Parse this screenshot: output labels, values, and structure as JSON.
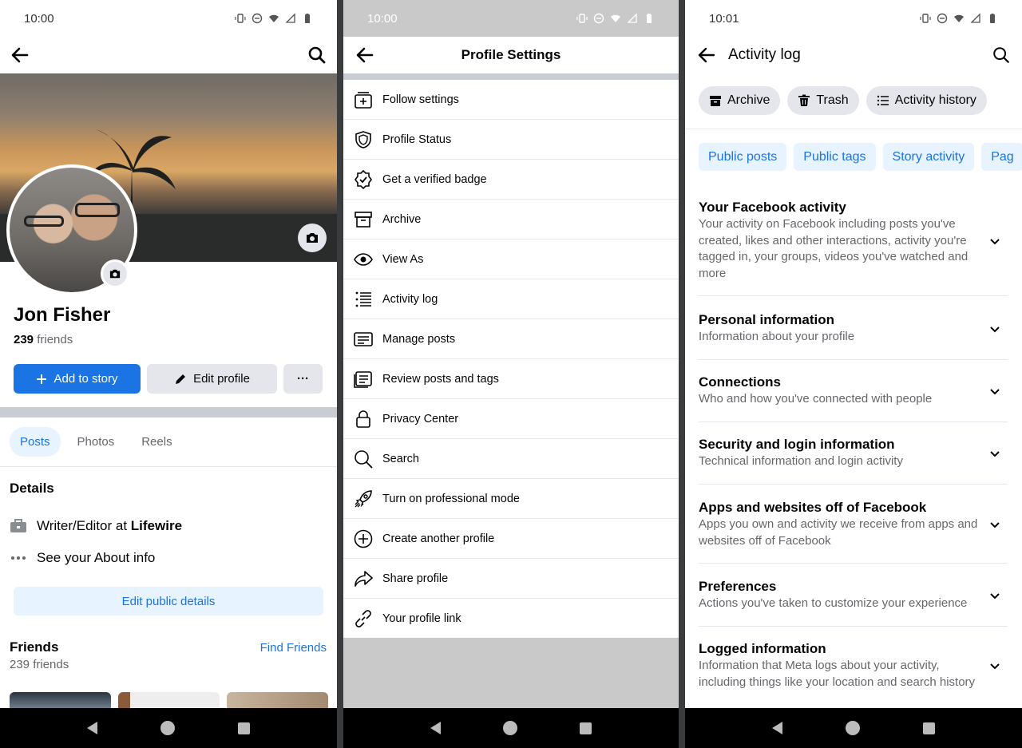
{
  "panel1": {
    "status_time": "10:00",
    "name": "Jon Fisher",
    "friends_count": "239",
    "friends_word": "friends",
    "add_story_label": "Add to story",
    "edit_profile_label": "Edit profile",
    "more_label": "···",
    "tabs": [
      {
        "label": "Posts",
        "active": true
      },
      {
        "label": "Photos",
        "active": false
      },
      {
        "label": "Reels",
        "active": false
      }
    ],
    "details_title": "Details",
    "work_prefix": "Writer/Editor at ",
    "work_company": "Lifewire",
    "about_label": "See your About info",
    "edit_public_label": "Edit public details",
    "friends_title": "Friends",
    "friends_sub": "239 friends",
    "find_friends_label": "Find Friends"
  },
  "panel2": {
    "status_time": "10:00",
    "title": "Profile Settings",
    "menu": [
      {
        "label": "Follow settings",
        "icon": "follow-icon"
      },
      {
        "label": "Profile Status",
        "icon": "shield-icon"
      },
      {
        "label": "Get a verified badge",
        "icon": "verified-badge-icon"
      },
      {
        "label": "Archive",
        "icon": "archive-icon"
      },
      {
        "label": "View As",
        "icon": "eye-icon"
      },
      {
        "label": "Activity log",
        "icon": "list-icon"
      },
      {
        "label": "Manage posts",
        "icon": "posts-icon"
      },
      {
        "label": "Review posts and tags",
        "icon": "review-icon"
      },
      {
        "label": "Privacy Center",
        "icon": "lock-icon"
      },
      {
        "label": "Search",
        "icon": "search-icon"
      },
      {
        "label": "Turn on professional mode",
        "icon": "rocket-icon"
      },
      {
        "label": "Create another profile",
        "icon": "plus-circle-icon"
      },
      {
        "label": "Share profile",
        "icon": "share-icon"
      },
      {
        "label": "Your profile link",
        "icon": "link-icon"
      }
    ]
  },
  "panel3": {
    "status_time": "10:01",
    "title": "Activity log",
    "chips": [
      {
        "label": "Archive",
        "icon": "archive-icon"
      },
      {
        "label": "Trash",
        "icon": "trash-icon"
      },
      {
        "label": "Activity history",
        "icon": "list-icon"
      }
    ],
    "pills": [
      "Public posts",
      "Public tags",
      "Story activity",
      "Pag"
    ],
    "sections": [
      {
        "title": "Your Facebook activity",
        "desc": "Your activity on Facebook including posts you've created, likes and other interactions, activity you're tagged in, your groups, videos you've watched and more"
      },
      {
        "title": "Personal information",
        "desc": "Information about your profile"
      },
      {
        "title": "Connections",
        "desc": "Who and how you've connected with people"
      },
      {
        "title": "Security and login information",
        "desc": "Technical information and login activity"
      },
      {
        "title": "Apps and websites off of Facebook",
        "desc": "Apps you own and activity we receive from apps and websites off of Facebook"
      },
      {
        "title": "Preferences",
        "desc": "Actions you've taken to customize your experience"
      },
      {
        "title": "Logged information",
        "desc": "Information that Meta logs about your activity, including things like your location and search history"
      }
    ]
  },
  "colors": {
    "accent": "#1b74e4",
    "accent_light": "#e7f3ff",
    "gray_button": "#e4e6eb",
    "secondary_text": "#65676b"
  }
}
